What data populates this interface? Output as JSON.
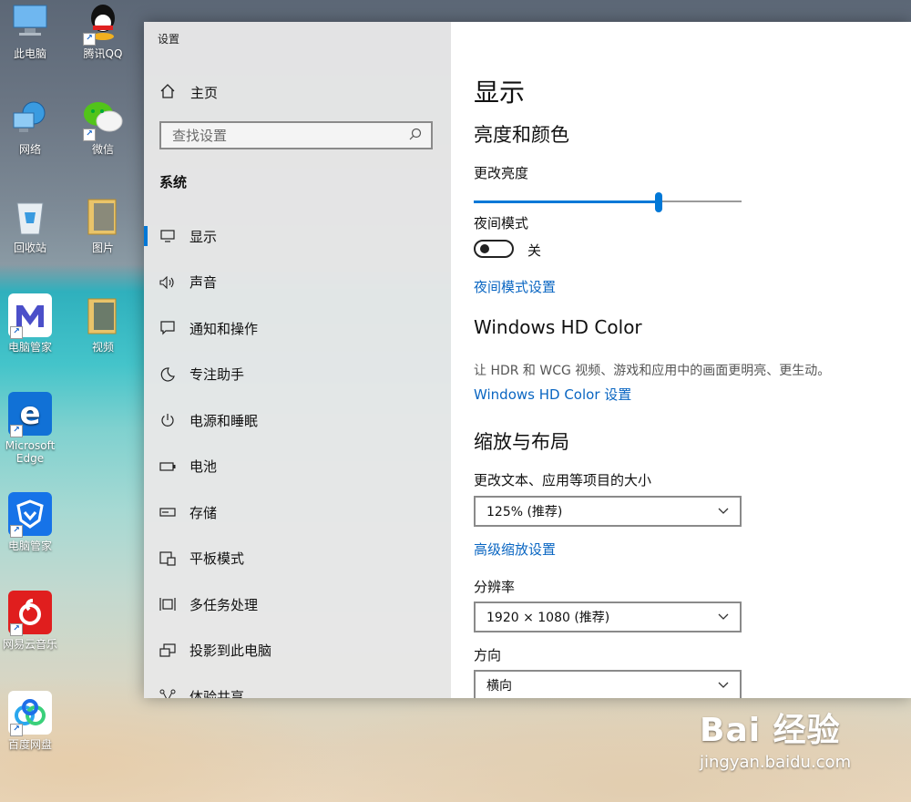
{
  "desktop": {
    "icons": [
      {
        "label": "此电脑",
        "icon": "computer-icon"
      },
      {
        "label": "腾讯QQ",
        "icon": "qq-icon"
      },
      {
        "label": "网络",
        "icon": "network-icon"
      },
      {
        "label": "微信",
        "icon": "wechat-icon"
      },
      {
        "label": "回收站",
        "icon": "recycle-bin-icon"
      },
      {
        "label": "图片",
        "icon": "folder-icon"
      },
      {
        "label": "电脑管家",
        "icon": "pc-manager-icon"
      },
      {
        "label": "视频",
        "icon": "folder-icon"
      },
      {
        "label": "Microsoft Edge",
        "icon": "edge-icon"
      },
      {
        "label": "电脑管家",
        "icon": "shield-icon"
      },
      {
        "label": "网易云音乐",
        "icon": "netease-music-icon"
      },
      {
        "label": "百度网盘",
        "icon": "baidu-netdisk-icon"
      }
    ]
  },
  "window": {
    "title": "设置",
    "sidebar": {
      "home_label": "主页",
      "search_placeholder": "查找设置",
      "section": "系统",
      "items": [
        {
          "label": "显示",
          "icon": "monitor-icon",
          "active": true
        },
        {
          "label": "声音",
          "icon": "speaker-icon"
        },
        {
          "label": "通知和操作",
          "icon": "message-icon"
        },
        {
          "label": "专注助手",
          "icon": "moon-icon"
        },
        {
          "label": "电源和睡眠",
          "icon": "power-icon"
        },
        {
          "label": "电池",
          "icon": "battery-icon"
        },
        {
          "label": "存储",
          "icon": "storage-icon"
        },
        {
          "label": "平板模式",
          "icon": "tablet-icon"
        },
        {
          "label": "多任务处理",
          "icon": "multitask-icon"
        },
        {
          "label": "投影到此电脑",
          "icon": "project-icon"
        },
        {
          "label": "体验共享",
          "icon": "share-icon"
        }
      ]
    },
    "content": {
      "title": "显示",
      "brightness_heading": "亮度和颜色",
      "brightness_label": "更改亮度",
      "brightness_value": 0.69,
      "night_mode_label": "夜间模式",
      "night_mode_state": "关",
      "night_mode_link": "夜间模式设置",
      "hd_heading": "Windows HD Color",
      "hd_desc": "让 HDR 和 WCG 视频、游戏和应用中的画面更明亮、更生动。",
      "hd_link": "Windows HD Color 设置",
      "scale_heading": "缩放与布局",
      "scale_label": "更改文本、应用等项目的大小",
      "scale_value": "125% (推荐)",
      "advanced_link": "高级缩放设置",
      "resolution_label": "分辨率",
      "resolution_value": "1920 × 1080 (推荐)",
      "orientation_label": "方向",
      "orientation_value": "横向"
    }
  },
  "watermark": {
    "brand": "Bai 经验",
    "url": "jingyan.baidu.com"
  }
}
